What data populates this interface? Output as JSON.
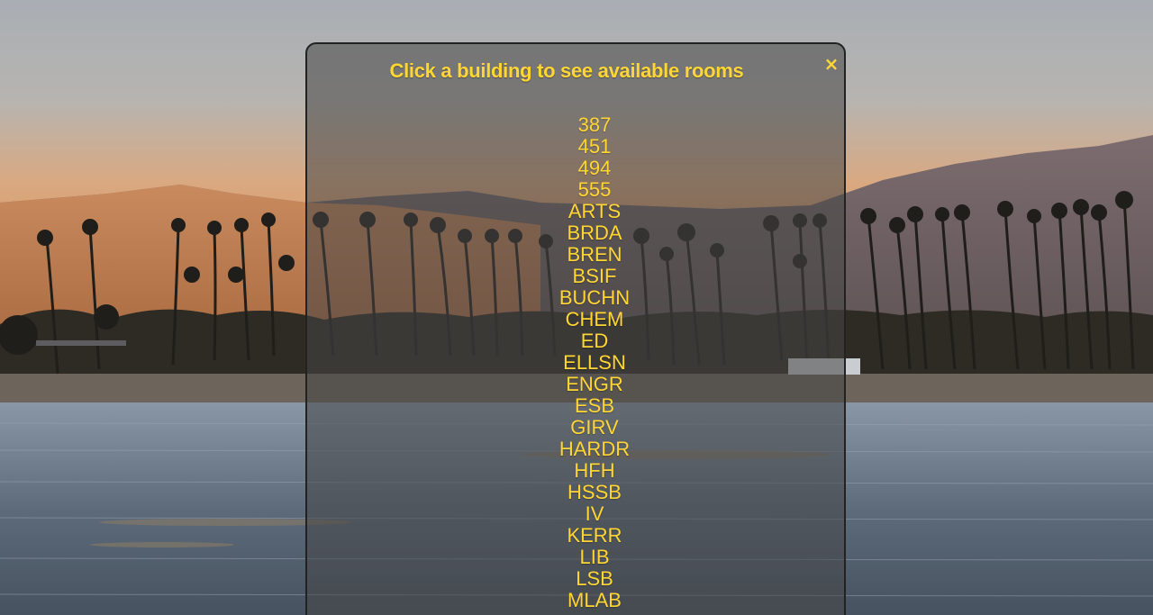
{
  "modal": {
    "title": "Click a building to see available rooms",
    "close_label": "×"
  },
  "buildings": [
    "387",
    "451",
    "494",
    "555",
    "ARTS",
    "BRDA",
    "BREN",
    "BSIF",
    "BUCHN",
    "CHEM",
    "ED",
    "ELLSN",
    "ENGR",
    "ESB",
    "GIRV",
    "HARDR",
    "HFH",
    "HSSB",
    "IV",
    "KERR",
    "LIB",
    "LSB",
    "MLAB"
  ],
  "colors": {
    "accent": "#ffd633",
    "modal_border": "#222222"
  },
  "background": {
    "description_icon": "beach-sunset-photo"
  }
}
